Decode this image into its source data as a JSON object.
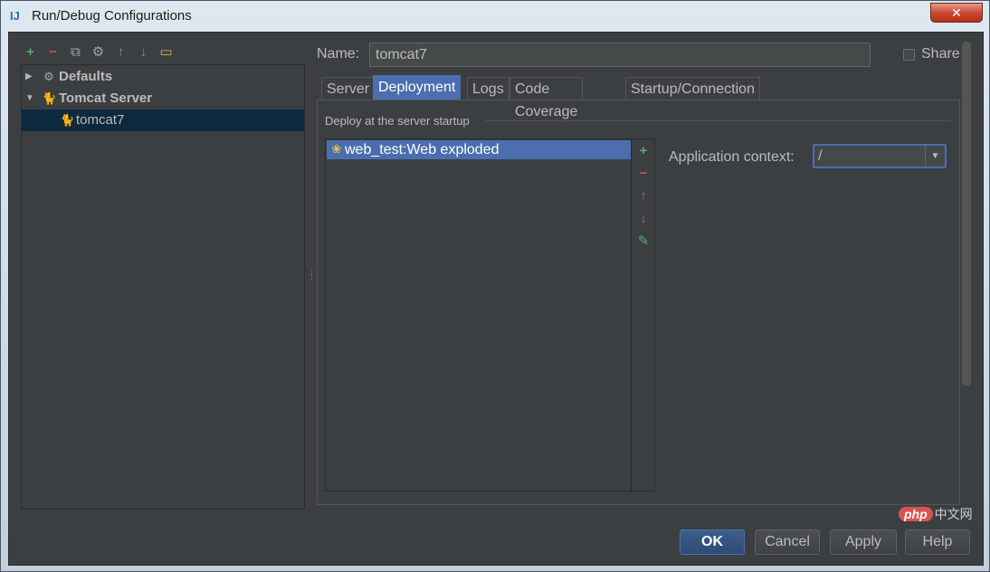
{
  "window": {
    "app_icon": "IJ",
    "title": "Run/Debug Configurations",
    "close_glyph": "✕"
  },
  "toolbar": {
    "icons": [
      "plus-icon",
      "minus-icon",
      "copy-icon",
      "wrench-icon",
      "arrow-up-icon",
      "arrow-down-icon",
      "folder-icon"
    ],
    "add": "+",
    "remove": "−",
    "copy": "⧉",
    "edit_defaults": "⚙",
    "move_up": "↑",
    "move_down": "↓",
    "folder": "▭"
  },
  "tree": {
    "defaults": {
      "label": "Defaults",
      "arrow": "▶"
    },
    "tomcat_server": {
      "label": "Tomcat Server",
      "arrow": "▼"
    },
    "tomcat7": {
      "label": "tomcat7"
    }
  },
  "form": {
    "name_label": "Name:",
    "name_value": "tomcat7",
    "share_label": "Share"
  },
  "tabs": [
    "Server",
    "Deployment",
    "Logs",
    "Code Coverage",
    "Startup/Connection"
  ],
  "active_tab": "Deployment",
  "deployment": {
    "section_label": "Deploy at the server startup",
    "items": [
      "web_test:Web exploded"
    ],
    "add": "+",
    "remove": "−",
    "move_up": "↑",
    "move_down": "↓",
    "edit": "✎",
    "context_label": "Application context:",
    "context_value": "/",
    "dropdown_glyph": "▼"
  },
  "buttons": {
    "ok": "OK",
    "cancel": "Cancel",
    "apply": "Apply",
    "help": "Help"
  },
  "watermark": {
    "badge": "php",
    "text": "中文网"
  },
  "colors": {
    "accent": "#4b6eaf",
    "background": "#3c3f41",
    "selection": "#0d293e",
    "add_green": "#59a869",
    "remove_red": "#c75450"
  }
}
